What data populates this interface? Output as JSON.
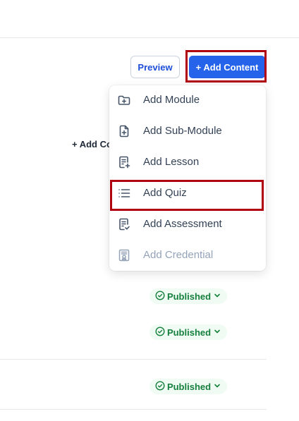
{
  "toolbar": {
    "preview_label": "Preview",
    "add_content_label": "+ Add Content"
  },
  "background": {
    "add_content_partial": "+ Add Co"
  },
  "menu": {
    "items": [
      {
        "label": "Add Module",
        "icon": "folder-plus-icon"
      },
      {
        "label": "Add Sub-Module",
        "icon": "file-plus-icon"
      },
      {
        "label": "Add Lesson",
        "icon": "document-plus-icon"
      },
      {
        "label": "Add Quiz",
        "icon": "list-icon"
      },
      {
        "label": "Add Assessment",
        "icon": "document-check-icon"
      },
      {
        "label": "Add Credential",
        "icon": "certificate-icon",
        "disabled": true
      }
    ]
  },
  "rows": [
    {
      "status": "Published"
    },
    {
      "status": "Published"
    },
    {
      "status": "Published"
    }
  ],
  "colors": {
    "accent": "#2563eb",
    "highlight": "#b00010",
    "published": "#15803d"
  }
}
